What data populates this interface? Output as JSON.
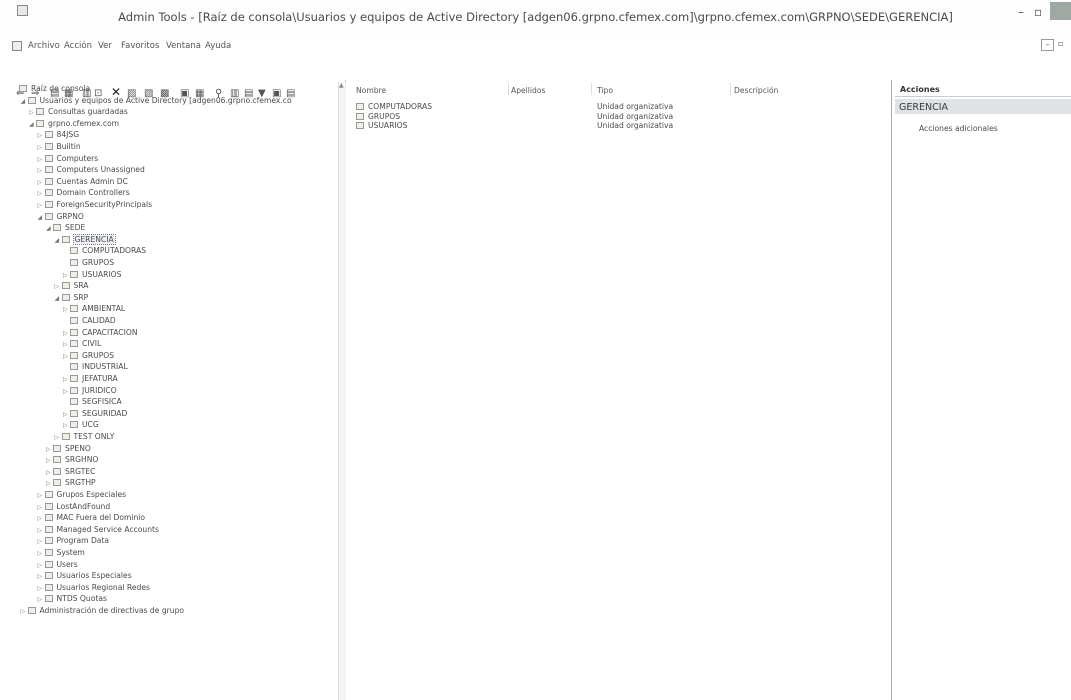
{
  "window": {
    "title": "Admin Tools - [Raíz de consola\\Usuarios y equipos de Active Directory [adgen06.grpno.cfemex.com]\\grpno.cfemex.com\\GRPNO\\SEDE\\GERENCIA]",
    "minimize_glyph": "–",
    "restore_glyph": "▫"
  },
  "menu": {
    "items": [
      "Archivo",
      "Acción",
      "Ver",
      "Favoritos",
      "Ventana",
      "Ayuda"
    ],
    "mdi_min": "–",
    "mdi_restore": "▫"
  },
  "toolbar": {
    "glyphs": [
      "⇐",
      "⇒",
      "▤",
      "▦",
      "▥",
      "⊡",
      "✕",
      "▨",
      "▧",
      "▩",
      "▣",
      "▦",
      "⚲",
      "▥",
      "▤",
      "▼",
      "▣",
      "▤"
    ]
  },
  "tree": [
    {
      "label": "Raíz de consola",
      "depth": 0,
      "arrow": ""
    },
    {
      "label": "Usuarios y equipos de Active Directory [adgen06.grpno.cfemex.co",
      "depth": 1,
      "arrow": "◢"
    },
    {
      "label": "Consultas guardadas",
      "depth": 2,
      "arrow": "▷"
    },
    {
      "label": "grpno.cfemex.com",
      "depth": 2,
      "arrow": "◢"
    },
    {
      "label": "84JSG",
      "depth": 3,
      "arrow": "▷"
    },
    {
      "label": "Builtin",
      "depth": 3,
      "arrow": "▷"
    },
    {
      "label": "Computers",
      "depth": 3,
      "arrow": "▷"
    },
    {
      "label": "Computers Unassigned",
      "depth": 3,
      "arrow": "▷"
    },
    {
      "label": "Cuentas Admin DC",
      "depth": 3,
      "arrow": "▷"
    },
    {
      "label": "Domain Controllers",
      "depth": 3,
      "arrow": "▷"
    },
    {
      "label": "ForeignSecurityPrincipals",
      "depth": 3,
      "arrow": "▷"
    },
    {
      "label": "GRPNO",
      "depth": 3,
      "arrow": "◢"
    },
    {
      "label": "SEDE",
      "depth": 4,
      "arrow": "◢"
    },
    {
      "label": "GERENCIA",
      "depth": 5,
      "arrow": "◢",
      "selected": true
    },
    {
      "label": "COMPUTADORAS",
      "depth": 6,
      "arrow": ""
    },
    {
      "label": "GRUPOS",
      "depth": 6,
      "arrow": ""
    },
    {
      "label": "USUARIOS",
      "depth": 6,
      "arrow": "▷"
    },
    {
      "label": "SRA",
      "depth": 5,
      "arrow": "▷"
    },
    {
      "label": "SRP",
      "depth": 5,
      "arrow": "◢"
    },
    {
      "label": "AMBIENTAL",
      "depth": 6,
      "arrow": "▷"
    },
    {
      "label": "CALIDAD",
      "depth": 6,
      "arrow": ""
    },
    {
      "label": "CAPACITACION",
      "depth": 6,
      "arrow": "▷"
    },
    {
      "label": "CIVIL",
      "depth": 6,
      "arrow": "▷"
    },
    {
      "label": "GRUPOS",
      "depth": 6,
      "arrow": "▷"
    },
    {
      "label": "INDUSTRIAL",
      "depth": 6,
      "arrow": ""
    },
    {
      "label": "JEFATURA",
      "depth": 6,
      "arrow": "▷"
    },
    {
      "label": "JURIDICO",
      "depth": 6,
      "arrow": "▷"
    },
    {
      "label": "SEGFISICA",
      "depth": 6,
      "arrow": ""
    },
    {
      "label": "SEGURIDAD",
      "depth": 6,
      "arrow": "▷"
    },
    {
      "label": "UCG",
      "depth": 6,
      "arrow": "▷"
    },
    {
      "label": "TEST ONLY",
      "depth": 5,
      "arrow": "▷"
    },
    {
      "label": "SPENO",
      "depth": 4,
      "arrow": "▷"
    },
    {
      "label": "SRGHNO",
      "depth": 4,
      "arrow": "▷"
    },
    {
      "label": "SRGTEC",
      "depth": 4,
      "arrow": "▷"
    },
    {
      "label": "SRGTHP",
      "depth": 4,
      "arrow": "▷"
    },
    {
      "label": "Grupos Especiales",
      "depth": 3,
      "arrow": "▷"
    },
    {
      "label": "LostAndFound",
      "depth": 3,
      "arrow": "▷"
    },
    {
      "label": "MAC Fuera del Dominio",
      "depth": 3,
      "arrow": "▷"
    },
    {
      "label": "Managed Service Accounts",
      "depth": 3,
      "arrow": "▷"
    },
    {
      "label": "Program Data",
      "depth": 3,
      "arrow": "▷"
    },
    {
      "label": "System",
      "depth": 3,
      "arrow": "▷"
    },
    {
      "label": "Users",
      "depth": 3,
      "arrow": "▷"
    },
    {
      "label": "Usuarios Especiales",
      "depth": 3,
      "arrow": "▷"
    },
    {
      "label": "Usuarios Regional Redes",
      "depth": 3,
      "arrow": "▷"
    },
    {
      "label": "NTDS Quotas",
      "depth": 3,
      "arrow": "▷"
    },
    {
      "label": "Administración de directivas de grupo",
      "depth": 1,
      "arrow": "▷"
    }
  ],
  "list": {
    "columns": [
      "Nombre",
      "Apellidos",
      "Tipo",
      "Descripción"
    ],
    "rows": [
      {
        "name": "COMPUTADORAS",
        "type": "Unidad organizativa"
      },
      {
        "name": "GRUPOS",
        "type": "Unidad organizativa"
      },
      {
        "name": "USUARIOS",
        "type": "Unidad organizativa"
      }
    ]
  },
  "actions": {
    "title": "Acciones",
    "group": "GERENCIA",
    "items": [
      "Acciones adicionales"
    ]
  }
}
